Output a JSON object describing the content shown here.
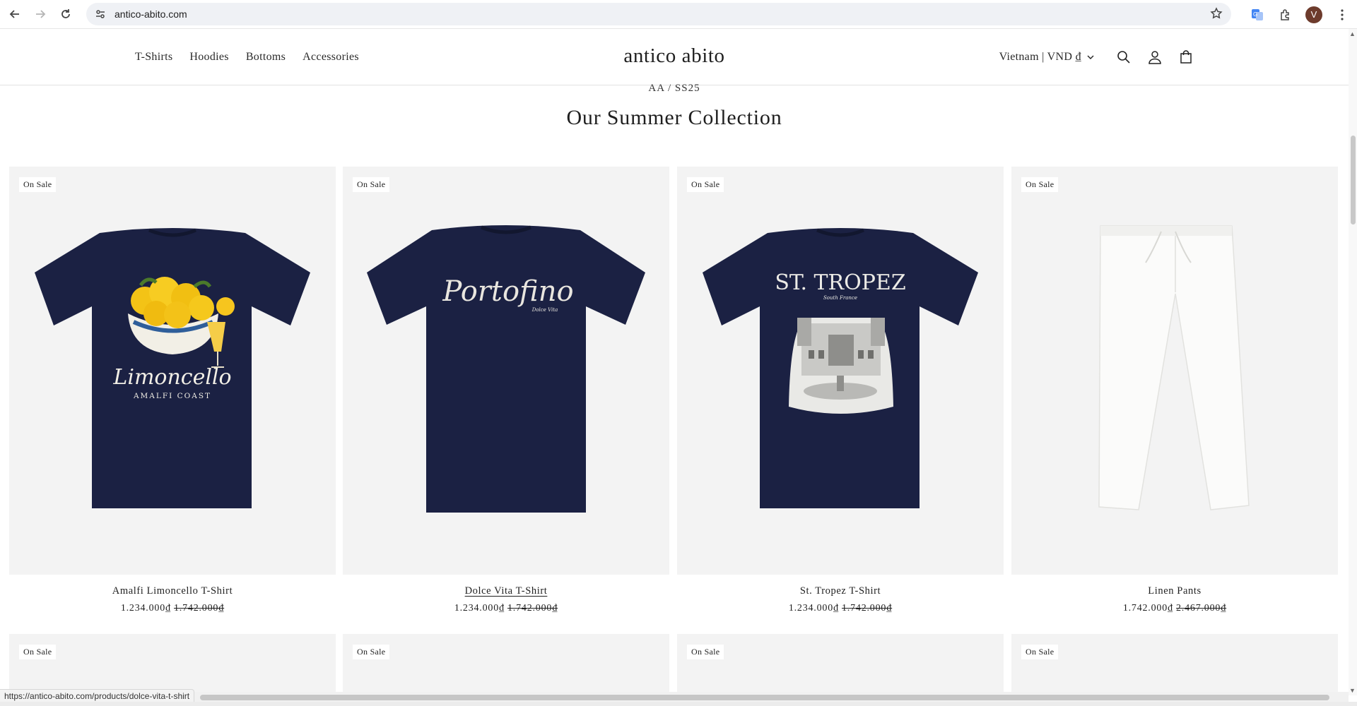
{
  "browser": {
    "url": "antico-abito.com",
    "profile_initial": "V",
    "status_url": "https://antico-abito.com/products/dolce-vita-t-shirt"
  },
  "header": {
    "nav": [
      "T-Shirts",
      "Hoodies",
      "Bottoms",
      "Accessories"
    ],
    "brand": "antico abito",
    "locale": "Vietnam | VND ₫"
  },
  "section": {
    "eyebrow": "AA / SS25",
    "title": "Our Summer Collection"
  },
  "products": [
    {
      "badge": "On Sale",
      "title": "Amalfi Limoncello T-Shirt",
      "price": "1.234.000₫",
      "compare": "1.742.000₫",
      "print_title": "Limoncello",
      "print_sub": "AMALFI COAST"
    },
    {
      "badge": "On Sale",
      "title": "Dolce Vita T-Shirt",
      "price": "1.234.000₫",
      "compare": "1.742.000₫",
      "print_title": "Portofino",
      "print_sub": "Dolce Vita"
    },
    {
      "badge": "On Sale",
      "title": "St. Tropez T-Shirt",
      "price": "1.234.000₫",
      "compare": "1.742.000₫",
      "print_title": "ST. TROPEZ",
      "print_sub": "South France"
    },
    {
      "badge": "On Sale",
      "title": "Linen Pants",
      "price": "1.742.000₫",
      "compare": "2.467.000₫"
    }
  ],
  "row2_badges": [
    "On Sale",
    "On Sale",
    "On Sale",
    "On Sale"
  ],
  "colors": {
    "navy": "#1b2143",
    "accent_bg": "#f3f3f3"
  }
}
